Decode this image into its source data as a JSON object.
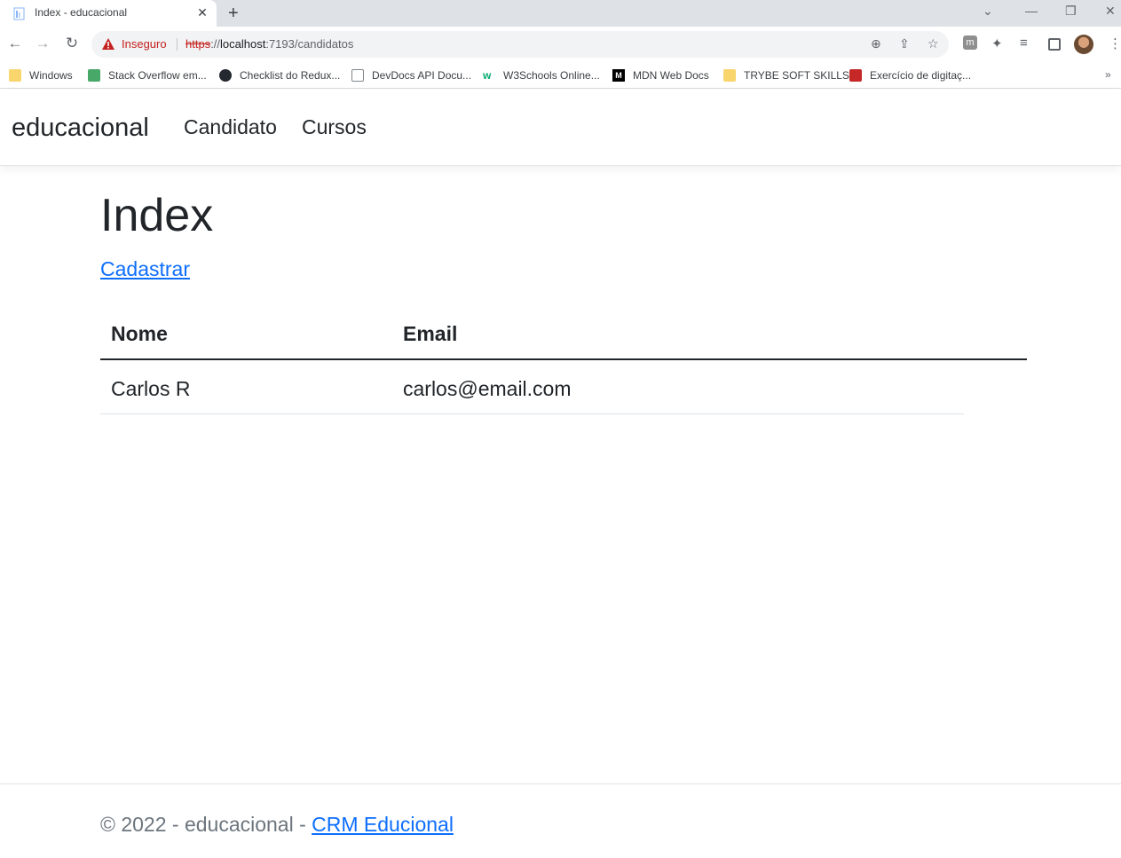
{
  "browser": {
    "tab_title": "Index - educacional",
    "tab_close": "✕",
    "new_tab": "+",
    "security_label": "Inseguro",
    "url_scheme": "https",
    "url_rest_prefix": "://",
    "url_host": "localhost",
    "url_path": ":7193/candidatos",
    "bookmarks": [
      {
        "label": "Windows",
        "icon": "folder-icon"
      },
      {
        "label": "Stack Overflow em...",
        "icon": "stackoverflow-icon"
      },
      {
        "label": "Checklist do Redux...",
        "icon": "github-icon"
      },
      {
        "label": "DevDocs API Docu...",
        "icon": "devdocs-icon"
      },
      {
        "label": "W3Schools Online...",
        "icon": "w3schools-icon"
      },
      {
        "label": "MDN Web Docs",
        "icon": "mdn-icon"
      },
      {
        "label": "TRYBE SOFT SKILLS",
        "icon": "folder-icon"
      },
      {
        "label": "Exercício de digitaç...",
        "icon": "typing-icon"
      }
    ]
  },
  "navbar": {
    "brand": "educacional",
    "links": [
      "Candidato",
      "Cursos"
    ]
  },
  "main": {
    "title": "Index",
    "create_link": "Cadastrar",
    "table": {
      "headers": [
        "Nome",
        "Email"
      ],
      "rows": [
        [
          "Carlos R",
          "carlos@email.com"
        ]
      ]
    }
  },
  "footer": {
    "text": "© 2022 - educacional - ",
    "link": "CRM Educional"
  },
  "colors": {
    "link": "#0d6efd",
    "insecure": "#c5221f"
  }
}
